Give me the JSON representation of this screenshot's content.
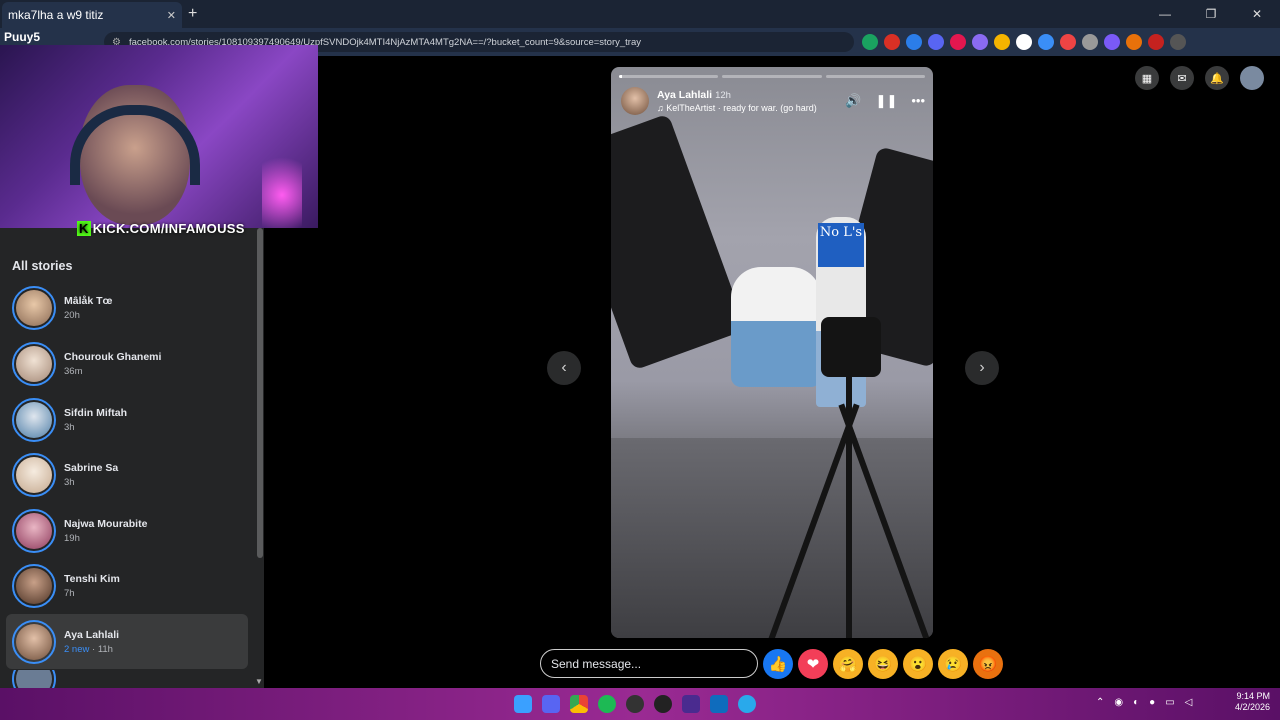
{
  "browser": {
    "tab_title": "mka7lha a w9 titiz",
    "new_tab": "+",
    "url": "facebook.com/stories/108109397490649/UzpfSVNDOjk4MTI4NjAzMTA4MTg2NA==/?bucket_count=9&source=story_tray",
    "profile_label": "Puuy5"
  },
  "overlay": {
    "kick_text": "KICK.COM/INFAMOUSS",
    "kick_badge": "K"
  },
  "sidebar": {
    "title": "All stories",
    "stories": [
      {
        "name": "Mâlåk Tœ",
        "time": "20h",
        "color": "#c9a07e"
      },
      {
        "name": "Chourouk Ghanemi",
        "time": "36m",
        "color": "#d9c2ae"
      },
      {
        "name": "Sifdin Miftah",
        "time": "3h",
        "color": "#6fa0c8"
      },
      {
        "name": "Sabrine Sa",
        "time": "3h",
        "color": "#e8d6c4"
      },
      {
        "name": "Najwa Mourabite",
        "time": "19h",
        "color": "#b8627e"
      },
      {
        "name": "Tenshi Kim",
        "time": "7h",
        "color": "#7b5a44"
      },
      {
        "name": "Aya Lahlali",
        "new": "2 new",
        "sep": " · ",
        "time": "11h",
        "color": "#8a5e4a"
      }
    ]
  },
  "story": {
    "author": "Aya Lahlali",
    "time": "12h",
    "song": "♫ KelTheArtist · ready for war. (go hard)",
    "sticker_text": "No L's",
    "segments": 3
  },
  "controls": {
    "mute_icon": "🔊",
    "pause_icon": "❚❚",
    "more_icon": "•••",
    "prev": "‹",
    "next": "›"
  },
  "message": {
    "placeholder": "Send message..."
  },
  "reactions": [
    "👍",
    "❤",
    "🤗",
    "😆",
    "😮",
    "😢",
    "😡"
  ],
  "taskbar": {
    "time": "9:14 PM",
    "date": "4/2/2026"
  }
}
